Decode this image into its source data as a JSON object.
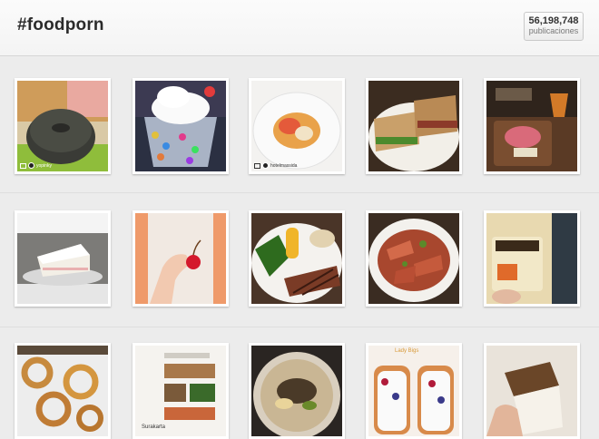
{
  "header": {
    "hashtag": "#foodporn",
    "post_count": "56,198,748",
    "post_count_label": "publicaciones"
  },
  "grid": {
    "photos": [
      {
        "subject": "black sesame donut",
        "caption": "yopinky"
      },
      {
        "subject": "whipped cream sundae with candies"
      },
      {
        "subject": "lobster plated dish",
        "caption": "hotelmassida"
      },
      {
        "subject": "panini sandwich"
      },
      {
        "subject": "charcuterie board with aperol"
      },
      {
        "subject": "slice of cake"
      },
      {
        "subject": "hand holding cherry"
      },
      {
        "subject": "steak with corn and greens"
      },
      {
        "subject": "sliced beef salad"
      },
      {
        "subject": "iced coffee cup"
      },
      {
        "subject": "onion rings sandwich"
      },
      {
        "subject": "sushi menu board",
        "caption": "Surakarta"
      },
      {
        "subject": "ramen bowl"
      },
      {
        "subject": "open sandwich with berries",
        "caption": "Lady Bigs"
      },
      {
        "subject": "cake slice in hand"
      }
    ]
  },
  "colors": {
    "background": "#ececec",
    "header_bg": "#f7f7f7"
  }
}
